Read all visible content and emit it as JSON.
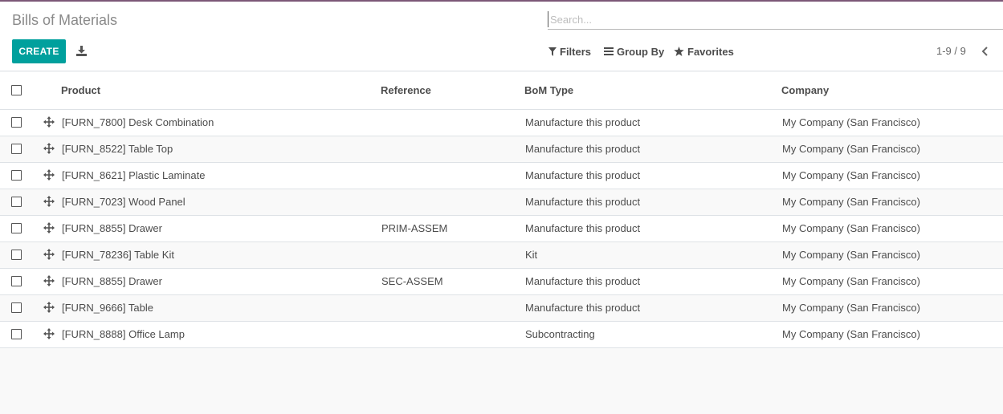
{
  "header": {
    "title": "Bills of Materials",
    "search_placeholder": "Search...",
    "create_label": "CREATE",
    "filters_label": "Filters",
    "groupby_label": "Group By",
    "favorites_label": "Favorites",
    "pager": "1-9 / 9"
  },
  "table": {
    "columns": {
      "product": "Product",
      "reference": "Reference",
      "bom_type": "BoM Type",
      "company": "Company"
    },
    "rows": [
      {
        "product": "[FURN_7800] Desk Combination",
        "reference": "",
        "bom_type": "Manufacture this product",
        "company": "My Company (San Francisco)"
      },
      {
        "product": "[FURN_8522] Table Top",
        "reference": "",
        "bom_type": "Manufacture this product",
        "company": "My Company (San Francisco)"
      },
      {
        "product": "[FURN_8621] Plastic Laminate",
        "reference": "",
        "bom_type": "Manufacture this product",
        "company": "My Company (San Francisco)"
      },
      {
        "product": "[FURN_7023] Wood Panel",
        "reference": "",
        "bom_type": "Manufacture this product",
        "company": "My Company (San Francisco)"
      },
      {
        "product": "[FURN_8855] Drawer",
        "reference": "PRIM-ASSEM",
        "bom_type": "Manufacture this product",
        "company": "My Company (San Francisco)"
      },
      {
        "product": "[FURN_78236] Table Kit",
        "reference": "",
        "bom_type": "Kit",
        "company": "My Company (San Francisco)"
      },
      {
        "product": "[FURN_8855] Drawer",
        "reference": "SEC-ASSEM",
        "bom_type": "Manufacture this product",
        "company": "My Company (San Francisco)"
      },
      {
        "product": "[FURN_9666] Table",
        "reference": "",
        "bom_type": "Manufacture this product",
        "company": "My Company (San Francisco)"
      },
      {
        "product": "[FURN_8888] Office Lamp",
        "reference": "",
        "bom_type": "Subcontracting",
        "company": "My Company (San Francisco)"
      }
    ]
  },
  "colors": {
    "accent": "#00a09d",
    "topbar": "#7c5777"
  },
  "icons": {
    "download": "download-icon",
    "filters": "filter-icon",
    "groupby": "bars-icon",
    "favorites": "star-icon",
    "pager_prev": "chevron-left-icon",
    "row_handle": "move-handle-icon"
  }
}
